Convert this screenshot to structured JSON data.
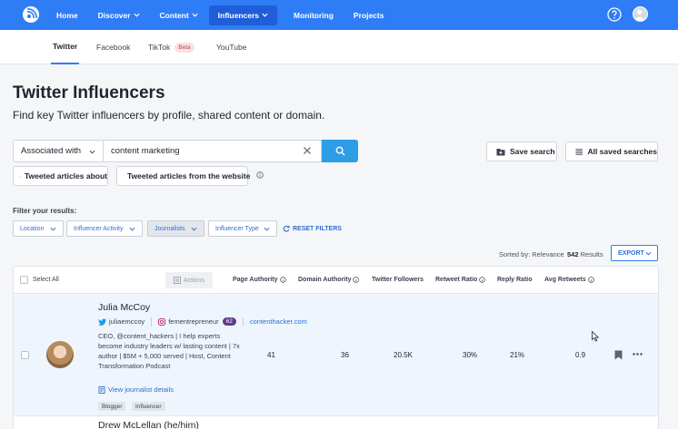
{
  "nav": {
    "items": [
      {
        "label": "Home",
        "dropdown": false,
        "active": false
      },
      {
        "label": "Discover",
        "dropdown": true,
        "active": false
      },
      {
        "label": "Content",
        "dropdown": true,
        "active": false
      },
      {
        "label": "Influencers",
        "dropdown": true,
        "active": true
      },
      {
        "label": "Monitoring",
        "dropdown": false,
        "active": false
      },
      {
        "label": "Projects",
        "dropdown": false,
        "active": false
      }
    ]
  },
  "tabs": [
    {
      "label": "Twitter",
      "active": true
    },
    {
      "label": "Facebook",
      "active": false
    },
    {
      "label": "TikTok",
      "active": false,
      "badge": "Beta"
    },
    {
      "label": "YouTube",
      "active": false
    }
  ],
  "page": {
    "title": "Twitter Influencers",
    "subtitle": "Find key Twitter influencers by profile, shared content or domain."
  },
  "search": {
    "mode": "Associated with",
    "query": "content marketing",
    "save_label": "Save search",
    "saved_label": "All saved searches",
    "option_a": "Tweeted articles about",
    "option_b": "Tweeted articles from the website"
  },
  "filters": {
    "label": "Filter your results:",
    "items": [
      "Location",
      "Influencer Activity",
      "Journalists",
      "Influencer Type"
    ],
    "reset": "RESET FILTERS"
  },
  "results": {
    "sorted": "Sorted by: Relevance",
    "count": "542",
    "count_suffix": "Results",
    "export": "EXPORT"
  },
  "table": {
    "select_all": "Select All",
    "actions": "Actions",
    "columns": [
      "Page Authority",
      "Domain Authority",
      "Twitter Followers",
      "Retweet Ratio",
      "Reply Ratio",
      "Avg Retweets"
    ],
    "rows": [
      {
        "name": "Julia McCoy",
        "twitter": "juliaemccoy",
        "instagram": "fementrepreneur",
        "instagram_count": "62",
        "website": "contenthacker.com",
        "bio": "CEO, @content_hackers | I help experts become industry leaders w/ lasting content | 7x author | $5M + 5,000 served | Host, Content Transformation Podcast",
        "view_details": "View journalist details",
        "tags": [
          "Blogger",
          "Influencer"
        ],
        "page_authority": "41",
        "domain_authority": "36",
        "followers": "20.5K",
        "retweet_ratio": "30%",
        "reply_ratio": "21%",
        "avg_retweets": "0.9"
      },
      {
        "name": "Drew McLellan (he/him)"
      }
    ]
  }
}
